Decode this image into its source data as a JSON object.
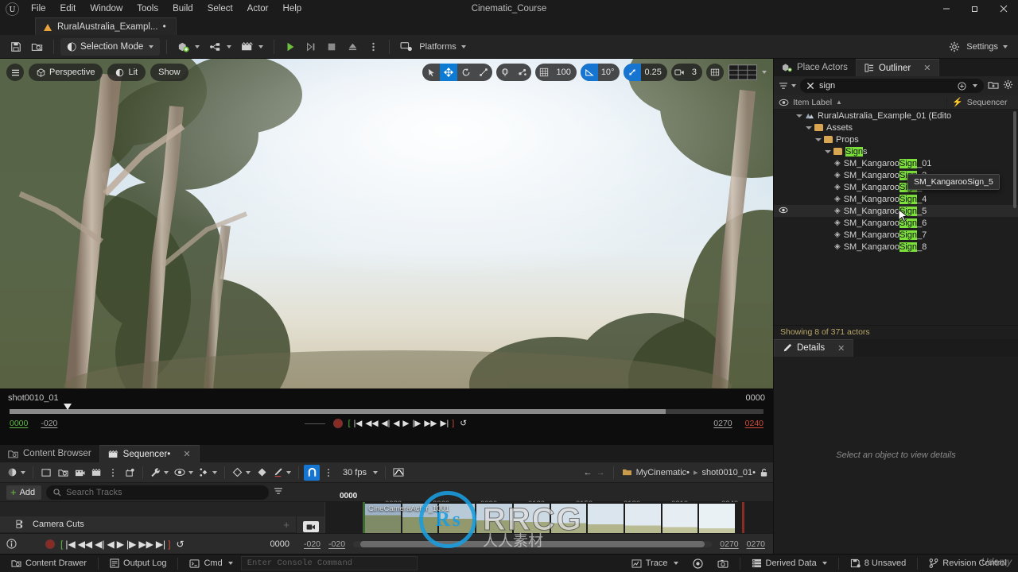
{
  "window": {
    "title": "Cinematic_Course",
    "minimize": "–",
    "maximize": "❐",
    "close": "✕"
  },
  "menu": {
    "items": [
      "File",
      "Edit",
      "Window",
      "Tools",
      "Build",
      "Select",
      "Actor",
      "Help"
    ]
  },
  "project_tab": {
    "label": "RuralAustralia_Exampl...",
    "dirty": "•"
  },
  "toolbar": {
    "save_title": "Save",
    "browse_title": "Browse",
    "selection_mode": "Selection Mode",
    "add_title": "Add",
    "blueprints_title": "Blueprints",
    "cinematics_title": "Cinematics",
    "play_title": "Play",
    "skip_title": "Skip",
    "stop_title": "Stop",
    "eject_title": "Eject",
    "more_title": "More",
    "platforms": "Platforms",
    "settings": "Settings"
  },
  "viewport": {
    "menu_title": "Viewport Options",
    "perspective": "Perspective",
    "lit": "Lit",
    "show": "Show",
    "select_title": "Select Mode",
    "move_title": "Move Mode",
    "rotate_title": "Rotate Mode",
    "scale_title": "Scale Mode",
    "coord_title": "World Coordinates",
    "surface_title": "Surface Snapping",
    "grid_snap_value": "100",
    "angle_snap_value": "10°",
    "scale_snap_value": "0.25",
    "camera_speed_value": "3",
    "grid_title": "Grid",
    "layout_title": "Viewport Layout"
  },
  "viewport_playback": {
    "shot_name": "shot0010_01",
    "end_frame_label": "0000",
    "current_frame": "0000",
    "start_range": "-020",
    "playback_end": "0270",
    "end_red": "0240",
    "controls": [
      "[",
      "|◀",
      "◀◀",
      "◀|",
      "◀",
      "▶",
      "|▶",
      "▶▶",
      "▶|",
      "]",
      "↺"
    ]
  },
  "panel_tabs": {
    "content_browser": "Content Browser",
    "sequencer": "Sequencer•",
    "close": "✕"
  },
  "sequencer": {
    "toolbar": {
      "world_title": "World",
      "create_camera_title": "Create Camera",
      "find_title": "Find in Content Browser",
      "render_title": "Render Movie",
      "take_title": "Take Recorder",
      "options_title": "Options",
      "actions_title": "Actions",
      "wrench_title": "Actions",
      "view_title": "View Options",
      "keys_title": "Key Options",
      "diamond_title": "Key Interpolation",
      "auto_key_title": "Auto Key",
      "curve_title": "Curve Editor",
      "snap_title": "Snapping",
      "snap_more_title": "Snap Settings",
      "fps": "30 fps",
      "curve_editor_title": "Curve Editor"
    },
    "breadcrumb": {
      "back": "←",
      "forward": "→",
      "root": "MyCinematic•",
      "sep": "▸",
      "current": "shot0010_01•",
      "lock_title": "Lock"
    },
    "add_button": "Add",
    "search_placeholder": "Search Tracks",
    "filter_title": "Filter",
    "track_header_icons": [
      "pin",
      "lock",
      "audio",
      "mute"
    ],
    "tracks": [
      {
        "name": "Camera Cuts",
        "icon": "camera-cuts-icon",
        "add": "+"
      }
    ],
    "section_label": "CineCameraActor_1001",
    "ruler": {
      "current_frame": "0000",
      "ticks": [
        "0030",
        "0060",
        "0090",
        "0120",
        "0150",
        "0180",
        "0210",
        "0240"
      ]
    },
    "transport": {
      "info_title": "Info",
      "record_title": "Record",
      "controls": [
        "[",
        "|◀",
        "◀◀",
        "◀|",
        "◀",
        "▶",
        "|▶",
        "▶▶",
        "▶|",
        "]",
        "↺"
      ],
      "current_frame": "0000",
      "in_a": "-020",
      "in_b": "-020",
      "out_a": "0270",
      "out_b": "0270"
    }
  },
  "outliner": {
    "tabs": {
      "place_actors": "Place Actors",
      "outliner": "Outliner",
      "close": "✕"
    },
    "filter_title": "Filter",
    "clear_title": "Clear",
    "search_value": "sign",
    "add_title": "Add",
    "settings_title": "Settings",
    "columns": {
      "item_label": "Item Label",
      "sort_arrow": "▲",
      "sequencer": "Sequencer"
    },
    "rows": [
      {
        "label": "RuralAustralia_Example_01 (Edito",
        "depth": 1,
        "type": "world",
        "expanded": true,
        "highlight": ""
      },
      {
        "label": "Assets",
        "depth": 2,
        "type": "folder",
        "expanded": true,
        "highlight": ""
      },
      {
        "label": "Props",
        "depth": 3,
        "type": "folder",
        "expanded": true,
        "highlight": ""
      },
      {
        "label": "Signs",
        "depth": 4,
        "type": "folder-open",
        "expanded": true,
        "highlight": "Sign"
      },
      {
        "label": "SM_KangarooSign_01",
        "depth": 5,
        "type": "mesh",
        "highlight": "Sign"
      },
      {
        "label": "SM_KangarooSign_2",
        "depth": 5,
        "type": "mesh",
        "highlight": "Sign"
      },
      {
        "label": "SM_KangarooSign_3",
        "depth": 5,
        "type": "mesh",
        "highlight": "Sign"
      },
      {
        "label": "SM_KangarooSign_4",
        "depth": 5,
        "type": "mesh",
        "highlight": "Sign"
      },
      {
        "label": "SM_KangarooSign_5",
        "depth": 5,
        "type": "mesh",
        "highlight": "Sign",
        "eye": true,
        "hovered": true
      },
      {
        "label": "SM_KangarooSign_6",
        "depth": 5,
        "type": "mesh",
        "highlight": "Sign"
      },
      {
        "label": "SM_KangarooSign_7",
        "depth": 5,
        "type": "mesh",
        "highlight": "Sign"
      },
      {
        "label": "SM_KangarooSign_8",
        "depth": 5,
        "type": "mesh",
        "highlight": "Sign"
      }
    ],
    "tooltip": "SM_KangarooSign_5",
    "status": "Showing 8 of 371 actors"
  },
  "details": {
    "tab": "Details",
    "close": "✕",
    "empty_message": "Select an object to view details"
  },
  "statusbar": {
    "content_drawer": "Content Drawer",
    "output_log": "Output Log",
    "cmd": "Cmd",
    "console_placeholder": "Enter Console Command",
    "trace": "Trace",
    "perf_title": "Performance",
    "camera_title": "Screenshot",
    "derived_data": "Derived Data",
    "unsaved": "8 Unsaved",
    "revision_control": "Revision Control"
  },
  "watermark": {
    "brand": "RRCG",
    "sub": "人人素材",
    "mark": "Udemy"
  },
  "colors": {
    "accent_blue": "#1675d1",
    "play_green": "#6fbf3f",
    "highlight_green": "#7ce03a",
    "warn_red": "#d04a3b",
    "folder_orange": "#c99a4a"
  }
}
